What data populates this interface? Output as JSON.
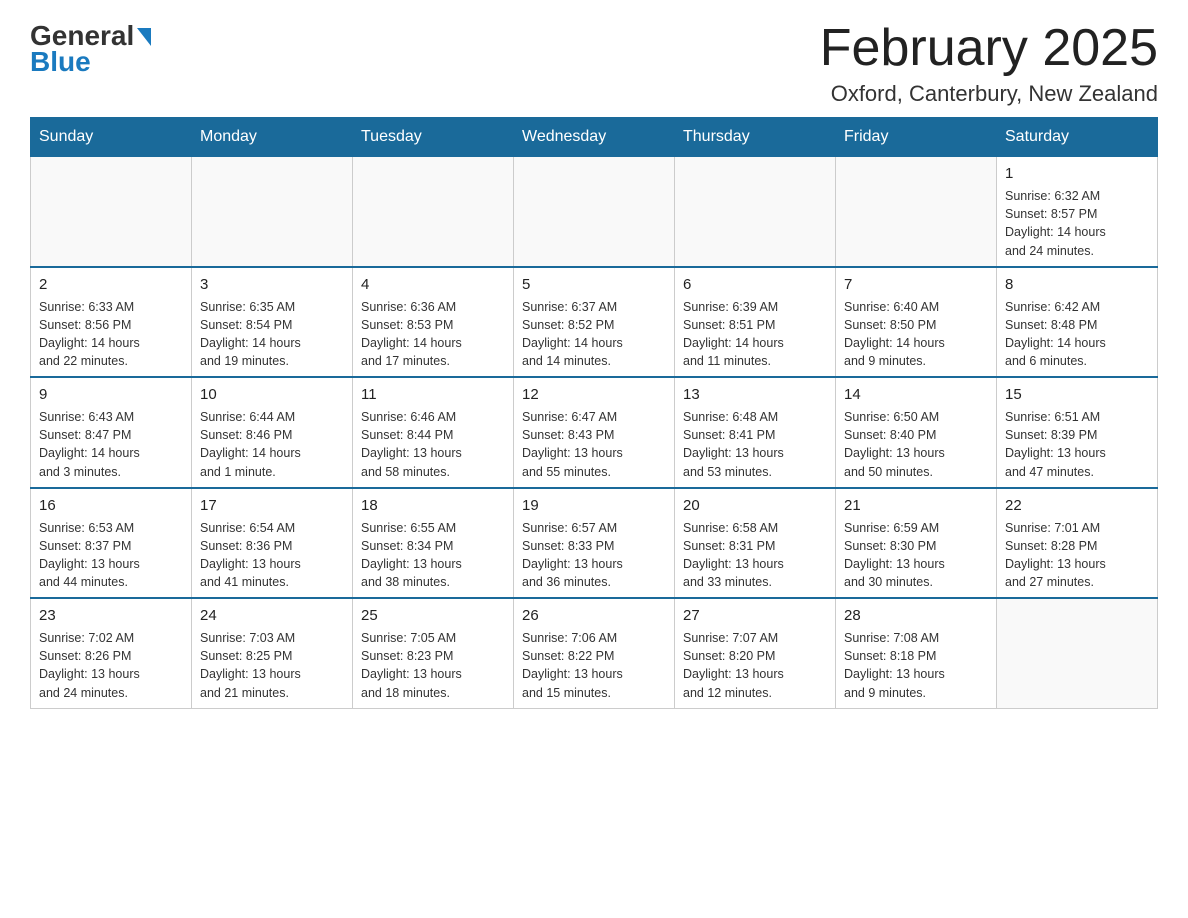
{
  "logo": {
    "general": "General",
    "blue": "Blue"
  },
  "header": {
    "month": "February 2025",
    "location": "Oxford, Canterbury, New Zealand"
  },
  "weekdays": [
    "Sunday",
    "Monday",
    "Tuesday",
    "Wednesday",
    "Thursday",
    "Friday",
    "Saturday"
  ],
  "weeks": [
    [
      {
        "day": "",
        "info": ""
      },
      {
        "day": "",
        "info": ""
      },
      {
        "day": "",
        "info": ""
      },
      {
        "day": "",
        "info": ""
      },
      {
        "day": "",
        "info": ""
      },
      {
        "day": "",
        "info": ""
      },
      {
        "day": "1",
        "info": "Sunrise: 6:32 AM\nSunset: 8:57 PM\nDaylight: 14 hours\nand 24 minutes."
      }
    ],
    [
      {
        "day": "2",
        "info": "Sunrise: 6:33 AM\nSunset: 8:56 PM\nDaylight: 14 hours\nand 22 minutes."
      },
      {
        "day": "3",
        "info": "Sunrise: 6:35 AM\nSunset: 8:54 PM\nDaylight: 14 hours\nand 19 minutes."
      },
      {
        "day": "4",
        "info": "Sunrise: 6:36 AM\nSunset: 8:53 PM\nDaylight: 14 hours\nand 17 minutes."
      },
      {
        "day": "5",
        "info": "Sunrise: 6:37 AM\nSunset: 8:52 PM\nDaylight: 14 hours\nand 14 minutes."
      },
      {
        "day": "6",
        "info": "Sunrise: 6:39 AM\nSunset: 8:51 PM\nDaylight: 14 hours\nand 11 minutes."
      },
      {
        "day": "7",
        "info": "Sunrise: 6:40 AM\nSunset: 8:50 PM\nDaylight: 14 hours\nand 9 minutes."
      },
      {
        "day": "8",
        "info": "Sunrise: 6:42 AM\nSunset: 8:48 PM\nDaylight: 14 hours\nand 6 minutes."
      }
    ],
    [
      {
        "day": "9",
        "info": "Sunrise: 6:43 AM\nSunset: 8:47 PM\nDaylight: 14 hours\nand 3 minutes."
      },
      {
        "day": "10",
        "info": "Sunrise: 6:44 AM\nSunset: 8:46 PM\nDaylight: 14 hours\nand 1 minute."
      },
      {
        "day": "11",
        "info": "Sunrise: 6:46 AM\nSunset: 8:44 PM\nDaylight: 13 hours\nand 58 minutes."
      },
      {
        "day": "12",
        "info": "Sunrise: 6:47 AM\nSunset: 8:43 PM\nDaylight: 13 hours\nand 55 minutes."
      },
      {
        "day": "13",
        "info": "Sunrise: 6:48 AM\nSunset: 8:41 PM\nDaylight: 13 hours\nand 53 minutes."
      },
      {
        "day": "14",
        "info": "Sunrise: 6:50 AM\nSunset: 8:40 PM\nDaylight: 13 hours\nand 50 minutes."
      },
      {
        "day": "15",
        "info": "Sunrise: 6:51 AM\nSunset: 8:39 PM\nDaylight: 13 hours\nand 47 minutes."
      }
    ],
    [
      {
        "day": "16",
        "info": "Sunrise: 6:53 AM\nSunset: 8:37 PM\nDaylight: 13 hours\nand 44 minutes."
      },
      {
        "day": "17",
        "info": "Sunrise: 6:54 AM\nSunset: 8:36 PM\nDaylight: 13 hours\nand 41 minutes."
      },
      {
        "day": "18",
        "info": "Sunrise: 6:55 AM\nSunset: 8:34 PM\nDaylight: 13 hours\nand 38 minutes."
      },
      {
        "day": "19",
        "info": "Sunrise: 6:57 AM\nSunset: 8:33 PM\nDaylight: 13 hours\nand 36 minutes."
      },
      {
        "day": "20",
        "info": "Sunrise: 6:58 AM\nSunset: 8:31 PM\nDaylight: 13 hours\nand 33 minutes."
      },
      {
        "day": "21",
        "info": "Sunrise: 6:59 AM\nSunset: 8:30 PM\nDaylight: 13 hours\nand 30 minutes."
      },
      {
        "day": "22",
        "info": "Sunrise: 7:01 AM\nSunset: 8:28 PM\nDaylight: 13 hours\nand 27 minutes."
      }
    ],
    [
      {
        "day": "23",
        "info": "Sunrise: 7:02 AM\nSunset: 8:26 PM\nDaylight: 13 hours\nand 24 minutes."
      },
      {
        "day": "24",
        "info": "Sunrise: 7:03 AM\nSunset: 8:25 PM\nDaylight: 13 hours\nand 21 minutes."
      },
      {
        "day": "25",
        "info": "Sunrise: 7:05 AM\nSunset: 8:23 PM\nDaylight: 13 hours\nand 18 minutes."
      },
      {
        "day": "26",
        "info": "Sunrise: 7:06 AM\nSunset: 8:22 PM\nDaylight: 13 hours\nand 15 minutes."
      },
      {
        "day": "27",
        "info": "Sunrise: 7:07 AM\nSunset: 8:20 PM\nDaylight: 13 hours\nand 12 minutes."
      },
      {
        "day": "28",
        "info": "Sunrise: 7:08 AM\nSunset: 8:18 PM\nDaylight: 13 hours\nand 9 minutes."
      },
      {
        "day": "",
        "info": ""
      }
    ]
  ]
}
